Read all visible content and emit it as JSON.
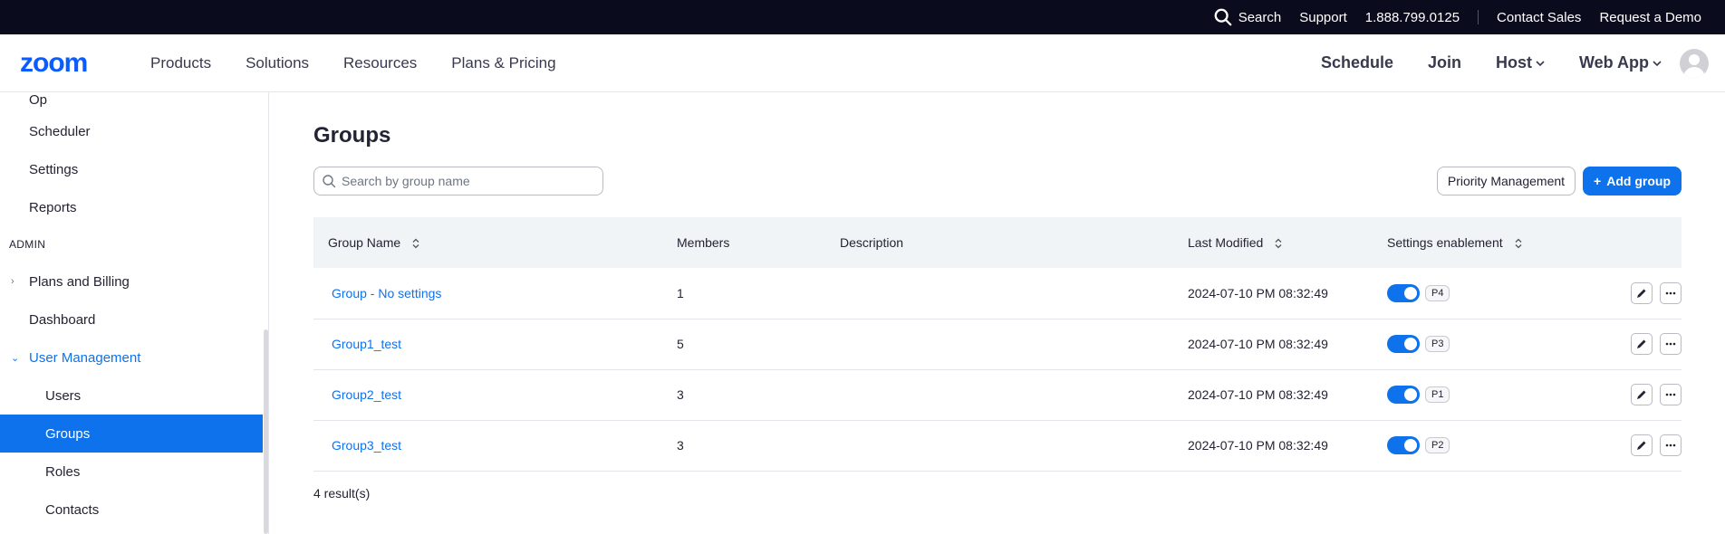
{
  "topbar": {
    "search": "Search",
    "support": "Support",
    "phone": "1.888.799.0125",
    "contact_sales": "Contact Sales",
    "request_demo": "Request a Demo"
  },
  "navbar": {
    "logo": "zoom",
    "products": "Products",
    "solutions": "Solutions",
    "resources": "Resources",
    "plans": "Plans & Pricing",
    "schedule": "Schedule",
    "join": "Join",
    "host": "Host",
    "web_app": "Web App"
  },
  "sidebar": {
    "partial": "Op",
    "scheduler": "Scheduler",
    "settings": "Settings",
    "reports": "Reports",
    "admin_header": "ADMIN",
    "plans_billing": "Plans and Billing",
    "dashboard": "Dashboard",
    "user_management": "User Management",
    "users": "Users",
    "groups": "Groups",
    "roles": "Roles",
    "contacts": "Contacts"
  },
  "main": {
    "title": "Groups",
    "search_placeholder": "Search by group name",
    "priority_button": "Priority Management",
    "add_button": "Add group",
    "columns": {
      "name": "Group Name",
      "members": "Members",
      "description": "Description",
      "modified": "Last Modified",
      "settings": "Settings enablement"
    },
    "rows": [
      {
        "name": "Group - No settings",
        "members": "1",
        "description": "",
        "modified": "2024-07-10 PM 08:32:49",
        "priority": "P4"
      },
      {
        "name": "Group1_test",
        "members": "5",
        "description": "",
        "modified": "2024-07-10 PM 08:32:49",
        "priority": "P3"
      },
      {
        "name": "Group2_test",
        "members": "3",
        "description": "",
        "modified": "2024-07-10 PM 08:32:49",
        "priority": "P1"
      },
      {
        "name": "Group3_test",
        "members": "3",
        "description": "",
        "modified": "2024-07-10 PM 08:32:49",
        "priority": "P2"
      }
    ],
    "results": "4 result(s)"
  },
  "colors": {
    "accent": "#0e72ed",
    "topbar_bg": "#0b0b1e"
  }
}
